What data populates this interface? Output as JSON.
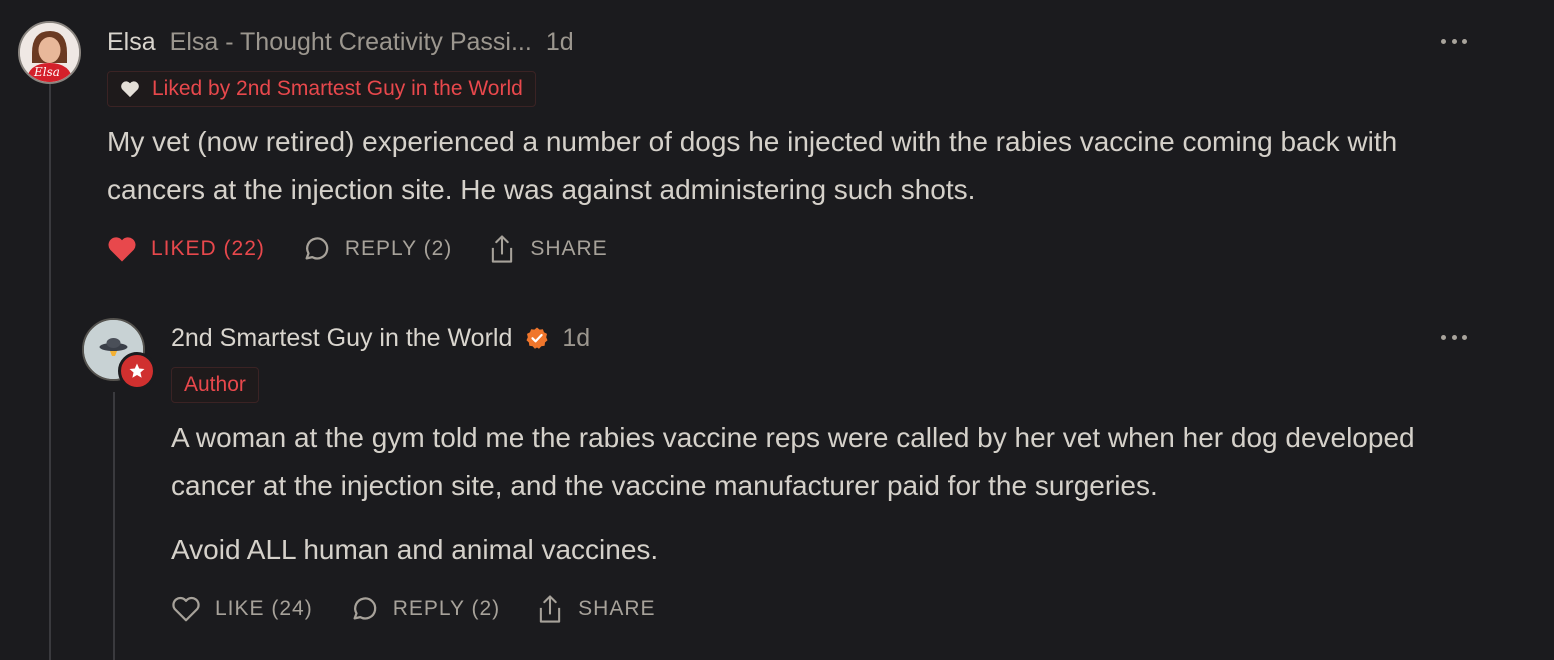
{
  "comments": [
    {
      "author": "Elsa",
      "publication": "Elsa - Thought Creativity Passi...",
      "age": "1d",
      "liked_by": "Liked by 2nd Smartest Guy in the World",
      "avatar_text": "Elsa",
      "body": [
        "My vet (now retired) experienced a number of dogs he injected with the rabies vaccine coming back with cancers at the injection site. He was against administering such shots."
      ],
      "like_label": "LIKED (22)",
      "reply_label": "REPLY (2)",
      "share_label": "SHARE"
    },
    {
      "author": "2nd Smartest Guy in the World",
      "age": "1d",
      "badge": "Author",
      "body": [
        "A woman at the gym told me the rabies vaccine reps were called by her vet when her dog developed cancer at the injection site, and the vaccine manufacturer paid for the surgeries.",
        "Avoid ALL human and animal vaccines."
      ],
      "like_label": "LIKE (24)",
      "reply_label": "REPLY (2)",
      "share_label": "SHARE"
    }
  ],
  "colors": {
    "background": "#1b1b1e",
    "accent_red": "#e8484c",
    "verified_orange": "#f0762c",
    "muted_text": "#9c978f"
  },
  "icons": [
    "heart-filled-icon",
    "heart-outline-icon",
    "comment-icon",
    "share-icon",
    "more-icon",
    "verified-icon",
    "star-badge-icon"
  ]
}
